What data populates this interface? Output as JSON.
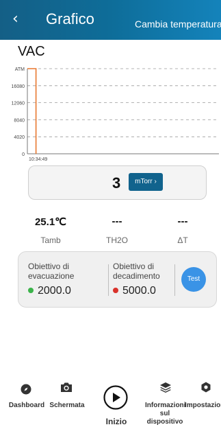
{
  "header": {
    "back_glyph": "‹",
    "title": "Grafico",
    "action": "Cambia temperatura"
  },
  "unit_label": "VAC",
  "chart_data": {
    "type": "line",
    "y_ticks": [
      "ATM",
      "16080",
      "12060",
      "8040",
      "4020",
      "0"
    ],
    "x_ticks": [
      "10:34:49"
    ],
    "ylim": [
      0,
      20100
    ],
    "series": [
      {
        "color": "#e8772e",
        "points": [
          [
            0,
            20100
          ],
          [
            0.3,
            20100
          ],
          [
            0.3,
            0
          ]
        ]
      }
    ],
    "grid": true
  },
  "reading": {
    "value": "3",
    "unit": "mTorr ›"
  },
  "stats": [
    {
      "value": "25.1℃",
      "label": "Tamb"
    },
    {
      "value": "---",
      "label": "TH2O"
    },
    {
      "value": "---",
      "label": "ΔT"
    }
  ],
  "targets": {
    "evacuation_label": "Obiettivo di evacuazione",
    "evacuation_value": "2000.0",
    "decay_label": "Obiettivo di decadimento",
    "decay_value": "5000.0",
    "test_button": "Test",
    "colors": {
      "evacuation": "#3bb34a",
      "decay": "#d9322b"
    }
  },
  "nav": {
    "dashboard": "Dashboard",
    "schermata": "Schermata",
    "inizio": "Inizio",
    "informazioni": "Informazioni sul dispositivo",
    "impostazioni": "Impostazioni",
    "icons": [
      "compass-icon",
      "camera-icon",
      "play-icon",
      "layers-icon",
      "gear-icon"
    ]
  }
}
